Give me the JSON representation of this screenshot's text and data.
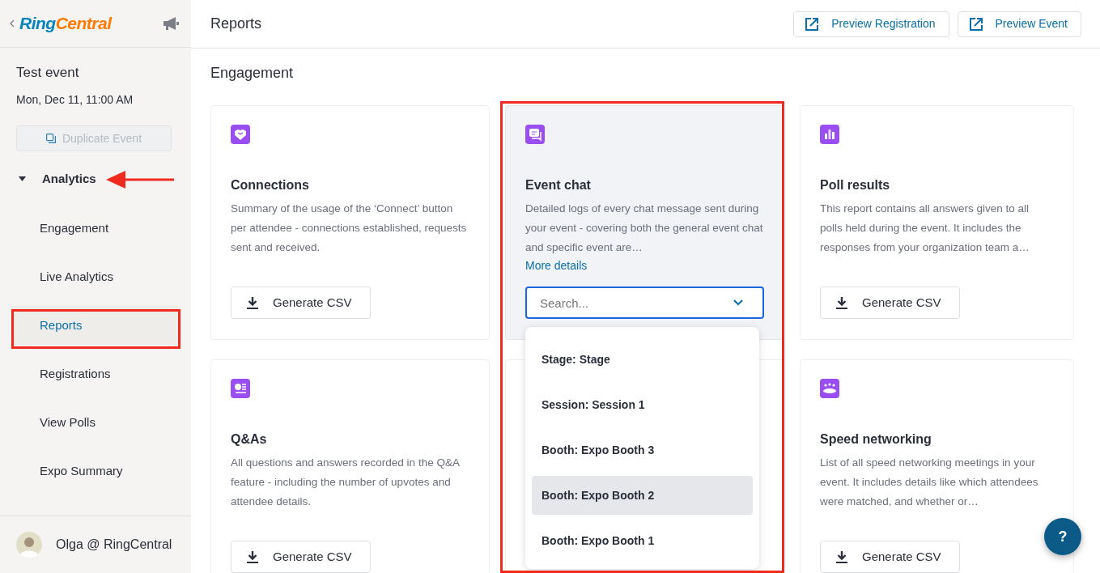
{
  "sidebar": {
    "logo": [
      "Ring",
      "Central"
    ],
    "event_title": "Test event",
    "event_date": "Mon, Dec 11, 11:00 AM",
    "duplicate_button": {
      "label": "Duplicate Event",
      "disabled": true
    },
    "nav": [
      {
        "label": "Analytics",
        "expanded": true,
        "children": [
          {
            "label": "Engagement",
            "selected": false
          },
          {
            "label": "Live Analytics",
            "selected": false
          },
          {
            "label": "Reports",
            "selected": true
          },
          {
            "label": "Registrations",
            "selected": false
          },
          {
            "label": "View Polls",
            "selected": false
          },
          {
            "label": "Expo Summary",
            "selected": false
          }
        ]
      }
    ],
    "user": {
      "name": "Olga @ RingCentral"
    }
  },
  "header": {
    "title": "Reports",
    "buttons": [
      "Preview Registration",
      "Preview Event"
    ]
  },
  "section_title": "Engagement",
  "cards": [
    {
      "kind": "handshake",
      "hovered": false,
      "title": "Connections",
      "description": "Summary of the usage of the ‘Connect’ button per attendee - connections established, requests sent and received.",
      "action": {
        "kind": "button",
        "label": "Generate CSV"
      }
    },
    {
      "kind": "chat",
      "hovered": true,
      "title": "Event chat",
      "description": "Detailed logs of every chat message sent during your event - covering both the general event chat and specific event are…",
      "link": "More details",
      "action": {
        "kind": "select",
        "placeholder": "Search...",
        "focused": true,
        "open": true,
        "options": [
          {
            "label": "Stage: Stage",
            "highlighted": false
          },
          {
            "label": "Session: Session 1",
            "highlighted": false
          },
          {
            "label": "Booth: Expo Booth 3",
            "highlighted": false
          },
          {
            "label": "Booth: Expo Booth 2",
            "highlighted": true
          },
          {
            "label": "Booth: Expo Booth 1",
            "highlighted": false
          }
        ]
      }
    },
    {
      "kind": "chart",
      "hovered": false,
      "title": "Poll results",
      "description": "This report contains all answers given to all polls held during the event. It includes the responses from your organization team a…",
      "action": {
        "kind": "button",
        "label": "Generate CSV"
      }
    },
    {
      "kind": "qa",
      "hovered": false,
      "title": "Q&As",
      "description": "All questions and answers recorded in the Q&A feature - including the number of upvotes and attendee details.",
      "action": {
        "kind": "button",
        "label": "Generate CSV"
      }
    },
    {
      "kind": "group",
      "hovered": false,
      "title": "Speed networking",
      "description": "List of all speed networking meetings in your event. It includes details like which attendees were matched, and whether or…",
      "action": {
        "kind": "button",
        "label": "Generate CSV"
      }
    }
  ],
  "help_button": "?"
}
